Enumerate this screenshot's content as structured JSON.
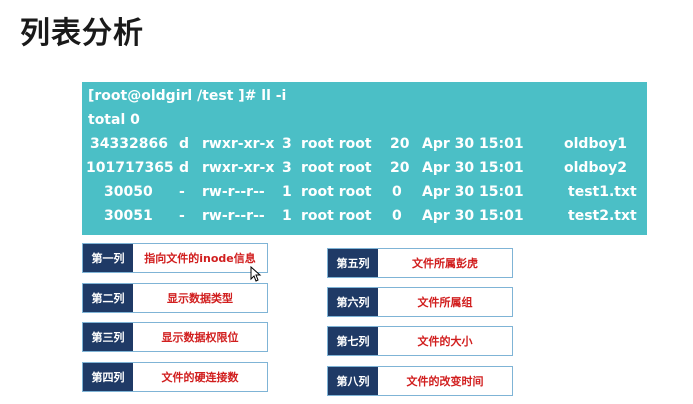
{
  "title": "列表分析",
  "terminal": {
    "prompt": "[root@oldgirl /test ]# ll -i",
    "total": "total 0",
    "rows": [
      {
        "inode": "34332866",
        "type": "d",
        "perm": "rwxr-xr-x",
        "links": "3",
        "owner": "root root",
        "size": "20",
        "date": "Apr 30 15:01",
        "name": "oldboy1"
      },
      {
        "inode": "101717365",
        "type": "d",
        "perm": "rwxr-xr-x",
        "links": "3",
        "owner": "root root",
        "size": "20",
        "date": "Apr 30 15:01",
        "name": "oldboy2"
      },
      {
        "inode": "30050",
        "type": "-",
        "perm": "rw-r--r--",
        "links": "1",
        "owner": "root root",
        "size": "0",
        "date": "Apr 30 15:01",
        "name": "test1.txt"
      },
      {
        "inode": "30051",
        "type": "-",
        "perm": "rw-r--r--",
        "links": "1",
        "owner": "root root",
        "size": "0",
        "date": "Apr 30 15:01",
        "name": "test2.txt"
      }
    ]
  },
  "columns": [
    {
      "key": "第一列",
      "desc": "指向文件的inode信息"
    },
    {
      "key": "第二列",
      "desc": "显示数据类型"
    },
    {
      "key": "第三列",
      "desc": "显示数据权限位"
    },
    {
      "key": "第四列",
      "desc": "文件的硬连接数"
    },
    {
      "key": "第五列",
      "desc": "文件所属彭虎"
    },
    {
      "key": "第六列",
      "desc": "文件所属组"
    },
    {
      "key": "第七列",
      "desc": "文件的大小"
    },
    {
      "key": "第八列",
      "desc": "文件的改变时间"
    }
  ],
  "colors": {
    "terminal_bg": "#4bbfc6",
    "key_bg": "#1f3a66",
    "desc_text": "#d11e1e"
  }
}
